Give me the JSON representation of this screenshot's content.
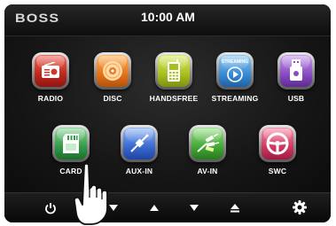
{
  "header": {
    "brand": "BOSS",
    "clock": "10:00 AM"
  },
  "apps_row1": [
    {
      "label": "RADIO",
      "icon": "radio-icon",
      "color": "#d2352a"
    },
    {
      "label": "DISC",
      "icon": "disc-icon",
      "color": "#e67c22"
    },
    {
      "label": "HANDSFREE",
      "icon": "phone-icon",
      "color": "#a9bf1f"
    },
    {
      "label": "STREAMING",
      "icon": "streaming-icon",
      "color": "#3b8cd3"
    },
    {
      "label": "USB",
      "icon": "usb-icon",
      "color": "#8a4cc4"
    }
  ],
  "apps_row2": [
    {
      "label": "CARD",
      "icon": "sd-card-icon",
      "color": "#2f9c46"
    },
    {
      "label": "AUX-IN",
      "icon": "aux-plug-icon",
      "color": "#3a69d0"
    },
    {
      "label": "AV-IN",
      "icon": "av-cable-icon",
      "color": "#43a836"
    },
    {
      "label": "SWC",
      "icon": "steering-wheel-icon",
      "color": "#d33661"
    }
  ],
  "streaming_badge": "STREAMING",
  "bottom_bar": [
    "power-icon",
    "volume-down-icon",
    "volume-up-icon",
    "down-arrow-icon",
    "eject-icon",
    "settings-gear-icon"
  ]
}
